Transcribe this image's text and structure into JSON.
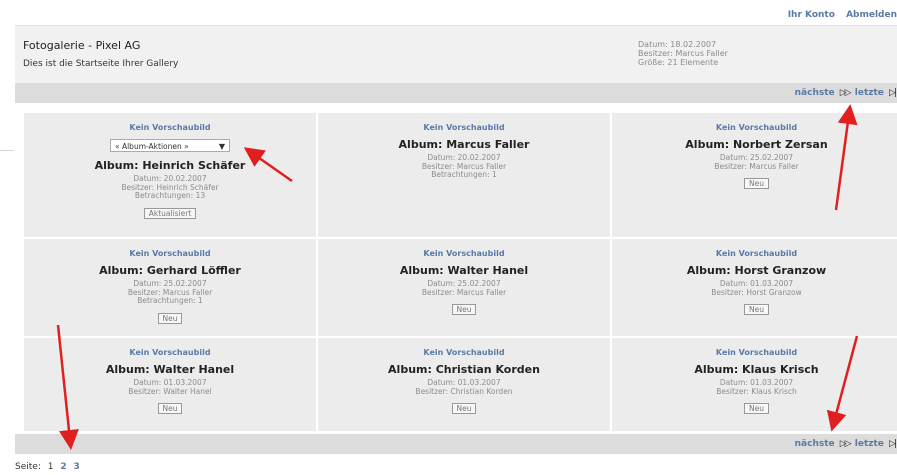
{
  "top_links": {
    "account": "Ihr Konto",
    "logout": "Abmelden"
  },
  "header": {
    "title": "Fotogalerie - Pixel AG",
    "subtitle": "Dies ist die Startseite Ihrer Gallery",
    "date": "Datum: 18.02.2007",
    "owner": "Besitzer: Marcus Faller",
    "size": "Größe: 21 Elemente"
  },
  "pager": {
    "next": "nächste",
    "last": "letzte",
    "next_icon": "▷▷",
    "last_icon": "▷|"
  },
  "album_actions": {
    "selected": "« Album-Aktionen »"
  },
  "albums": [
    {
      "nopic": "Kein Vorschaubild",
      "name": "Album: Heinrich Schäfer",
      "date": "Datum: 20.02.2007",
      "owner": "Besitzer: Heinrich Schäfer",
      "views": "Betrachtungen: 13",
      "badge": "Aktualisiert"
    },
    {
      "nopic": "Kein Vorschaubild",
      "name": "Album: Marcus Faller",
      "date": "Datum: 20.02.2007",
      "owner": "Besitzer: Marcus Faller",
      "views": "Betrachtungen: 1",
      "badge": ""
    },
    {
      "nopic": "Kein Vorschaubild",
      "name": "Album: Norbert Zersan",
      "date": "Datum: 25.02.2007",
      "owner": "Besitzer: Marcus Faller",
      "views": "",
      "badge": "Neu"
    },
    {
      "nopic": "Kein Vorschaubild",
      "name": "Album: Gerhard Löffler",
      "date": "Datum: 25.02.2007",
      "owner": "Besitzer: Marcus Faller",
      "views": "Betrachtungen: 1",
      "badge": "Neu"
    },
    {
      "nopic": "Kein Vorschaubild",
      "name": "Album: Walter Hanel",
      "date": "Datum: 25.02.2007",
      "owner": "Besitzer: Marcus Faller",
      "views": "",
      "badge": "Neu"
    },
    {
      "nopic": "Kein Vorschaubild",
      "name": "Album: Horst Granzow",
      "date": "Datum: 01.03.2007",
      "owner": "Besitzer: Horst Granzow",
      "views": "",
      "badge": "Neu"
    },
    {
      "nopic": "Kein Vorschaubild",
      "name": "Album: Walter Hanel",
      "date": "Datum: 01.03.2007",
      "owner": "Besitzer: Walter Hanel",
      "views": "",
      "badge": "Neu"
    },
    {
      "nopic": "Kein Vorschaubild",
      "name": "Album: Christian Korden",
      "date": "Datum: 01.03.2007",
      "owner": "Besitzer: Christian Korden",
      "views": "",
      "badge": "Neu"
    },
    {
      "nopic": "Kein Vorschaubild",
      "name": "Album: Klaus Krisch",
      "date": "Datum: 01.03.2007",
      "owner": "Besitzer: Klaus Krisch",
      "views": "",
      "badge": "Neu"
    }
  ],
  "pagination": {
    "label": "Seite:",
    "pages": [
      "1",
      "2",
      "3"
    ]
  },
  "colors": {
    "link": "#5a7aa6",
    "annotation_arrow": "#e02020",
    "cell_bg": "#ececec",
    "bar_bg": "#dcdcdc"
  }
}
